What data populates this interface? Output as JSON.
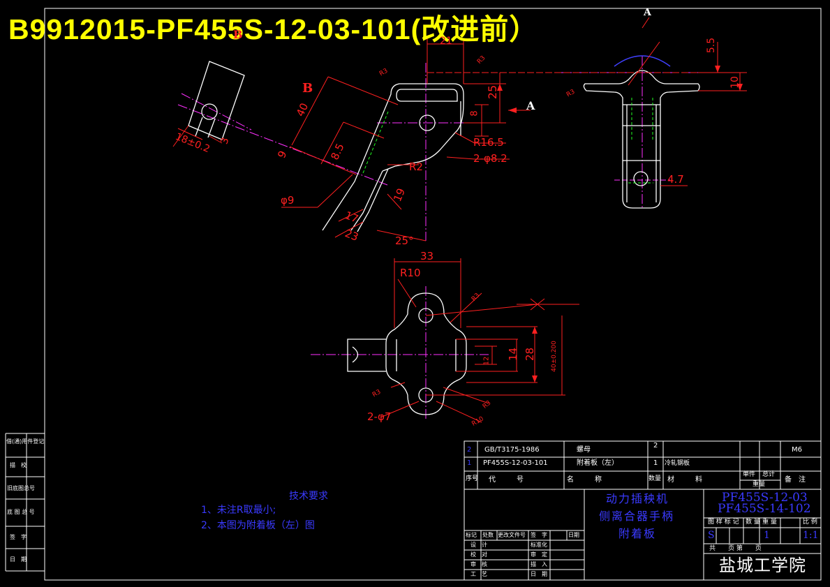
{
  "drawing": {
    "banner_title": "B9912015-PF455S-12-03-101(改进前）",
    "tech_req_title": "技术要求",
    "tech_req_1": "1、未注R取最小;",
    "tech_req_2": "2、本图为附着板（左）图"
  },
  "dims": {
    "d21": "21",
    "d5_5": "5.5",
    "d10": "10",
    "d25": "25",
    "d8": "8",
    "d40": "40",
    "d8_5": "8.5",
    "d9": "9",
    "d3": "3",
    "d18": "18±0.2",
    "d17": "17",
    "d23": "23",
    "d19": "19",
    "d25deg": "25°",
    "r16_5": "R16.5",
    "h2_8_2": "2-φ8.2",
    "r2": "R2",
    "phi9": "φ9",
    "d4_7": "4.7",
    "d33": "33",
    "r10": "R10",
    "d14": "14",
    "d28": "28",
    "d12": "12",
    "d40_2": "40±0.200",
    "h2_7": "2-φ7",
    "r3a": "R3",
    "r3b": "R3",
    "r3c": "R3",
    "r3d": "R3",
    "r3e": "R3",
    "r3f": "R3",
    "r10b": "R10",
    "view_a": "A",
    "view_a2": "A",
    "view_b": "B",
    "view_b2": "B"
  },
  "bom": {
    "row2": {
      "seq": "2",
      "code": "GB/T3175-1986",
      "name": "螺母",
      "qty": "2",
      "note": "M6"
    },
    "row1": {
      "seq": "1",
      "code": "PF455S-12-03-101",
      "name": "附着板（左）",
      "qty": "1",
      "material": "冷轧钢板"
    },
    "header": {
      "seq": "序号",
      "code": "代　　　号",
      "name": "名　　　称",
      "qty": "数量",
      "material": "材　　　料",
      "unit_wt": "单件",
      "total_wt": "总计",
      "wt": "重量",
      "note": "备　注"
    }
  },
  "titleblock": {
    "product_line1": "动力插秧机",
    "product_line2": "侧离合器手柄",
    "product_line3": "附着板",
    "dwg_no_1": "PF455S-12-03",
    "dwg_no_2": "PF455S-14-102",
    "stage_label": "图 样 标 记",
    "qty_label": "数 量",
    "weight_label": "重 量",
    "scale_label": "比 例",
    "stage_val": "S",
    "qty_val": "1",
    "scale_val": "1:1",
    "sheet_label": "共　　页 第　　页",
    "school": "盐城工学院",
    "rev_headers": [
      "标记",
      "处数",
      "更改文件号",
      "签　字",
      "日期"
    ],
    "sign_rows": [
      {
        "left": "设　计",
        "right": "标准化"
      },
      {
        "left": "校　对",
        "right": "审　定"
      },
      {
        "left": "审　核",
        "right": "描　入"
      },
      {
        "left": "工　艺",
        "right": "日　期"
      }
    ]
  },
  "sidebar": {
    "items": [
      "借(通)用件登记",
      "描　校",
      "旧底图总号",
      "底 图 总 号",
      "签　字",
      "日　期"
    ]
  }
}
